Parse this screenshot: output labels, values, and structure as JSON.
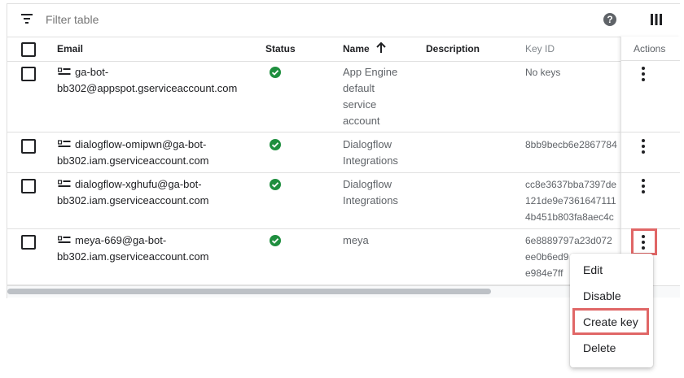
{
  "toolbar": {
    "filter_placeholder": "Filter table",
    "help_glyph": "?"
  },
  "table": {
    "columns": [
      "Email",
      "Status",
      "Name",
      "Description",
      "Key ID",
      "Actions"
    ],
    "rows": [
      {
        "email_lines": [
          "ga-bot-",
          "bb302@appspot.gserviceaccount.com"
        ],
        "status": "enabled",
        "name_lines": [
          "App Engine",
          "default",
          "service",
          "account"
        ],
        "description": "",
        "key_lines": [
          "No keys"
        ]
      },
      {
        "email_lines": [
          "dialogflow-omipwn@ga-bot-",
          "bb302.iam.gserviceaccount.com"
        ],
        "status": "enabled",
        "name_lines": [
          "Dialogflow",
          "Integrations"
        ],
        "description": "",
        "key_lines": [
          "8bb9becb6e2867784"
        ]
      },
      {
        "email_lines": [
          "dialogflow-xghufu@ga-bot-",
          "bb302.iam.gserviceaccount.com"
        ],
        "status": "enabled",
        "name_lines": [
          "Dialogflow",
          "Integrations"
        ],
        "description": "",
        "key_lines": [
          "cc8e3637bba7397de",
          "121de9e7361647111",
          "4b451b803fa8aec4c"
        ]
      },
      {
        "email_lines": [
          "meya-669@ga-bot-",
          "bb302.iam.gserviceaccount.com"
        ],
        "status": "enabled",
        "name_lines": [
          "meya"
        ],
        "description": "",
        "key_lines": [
          "6e8889797a23d072",
          "ee0b6ed9",
          "e984e7ff"
        ]
      }
    ]
  },
  "menu": {
    "items": [
      "Edit",
      "Disable",
      "Create key",
      "Delete"
    ],
    "highlighted": "Create key"
  },
  "colors": {
    "status_ok": "#1e8e3e",
    "highlight": "#e06666"
  }
}
